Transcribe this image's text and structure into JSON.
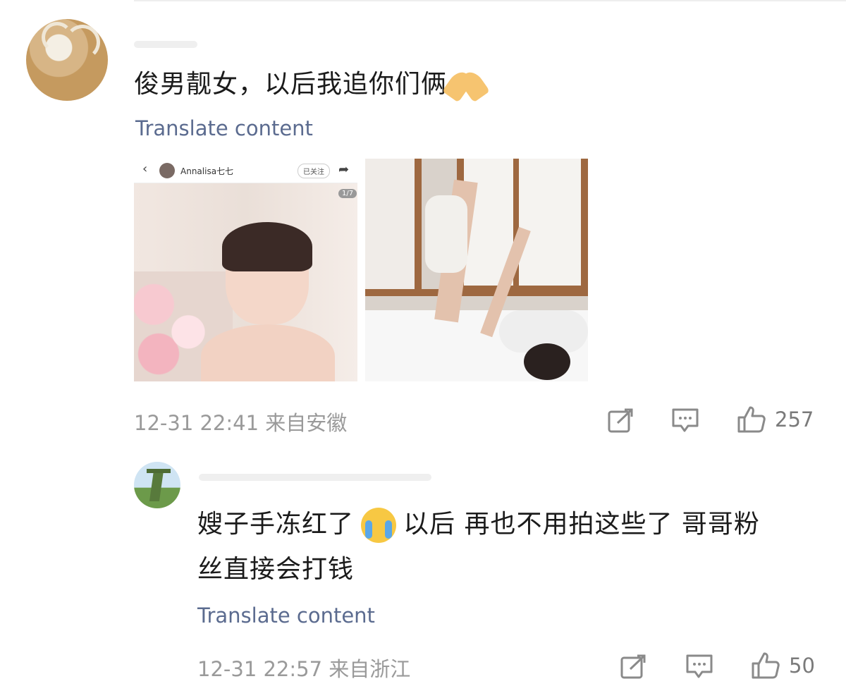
{
  "comments": [
    {
      "text": "俊男靓女，以后我追你们俩",
      "emoji": "folded-hands",
      "translate": "Translate content",
      "time": "12-31 22:41",
      "location": "来自安徽",
      "likes": "257"
    },
    {
      "text_part1": "嫂子手冻红了",
      "emoji": "loudly-crying-face",
      "text_part2": "以后 再也不用拍这些了 哥哥粉",
      "text_line2": "丝直接会打钱",
      "translate": "Translate content",
      "time": "12-31 22:57",
      "location": "来自浙江",
      "likes": "50"
    }
  ],
  "attached_screenshot": {
    "username": "Annalisa七七",
    "follow_label": "已关注",
    "page_counter": "1/7"
  },
  "icons": [
    "share-icon",
    "comment-icon",
    "like-icon"
  ],
  "colors": {
    "translate_link": "#5b6b8f",
    "meta_text": "#9a9a9a"
  }
}
